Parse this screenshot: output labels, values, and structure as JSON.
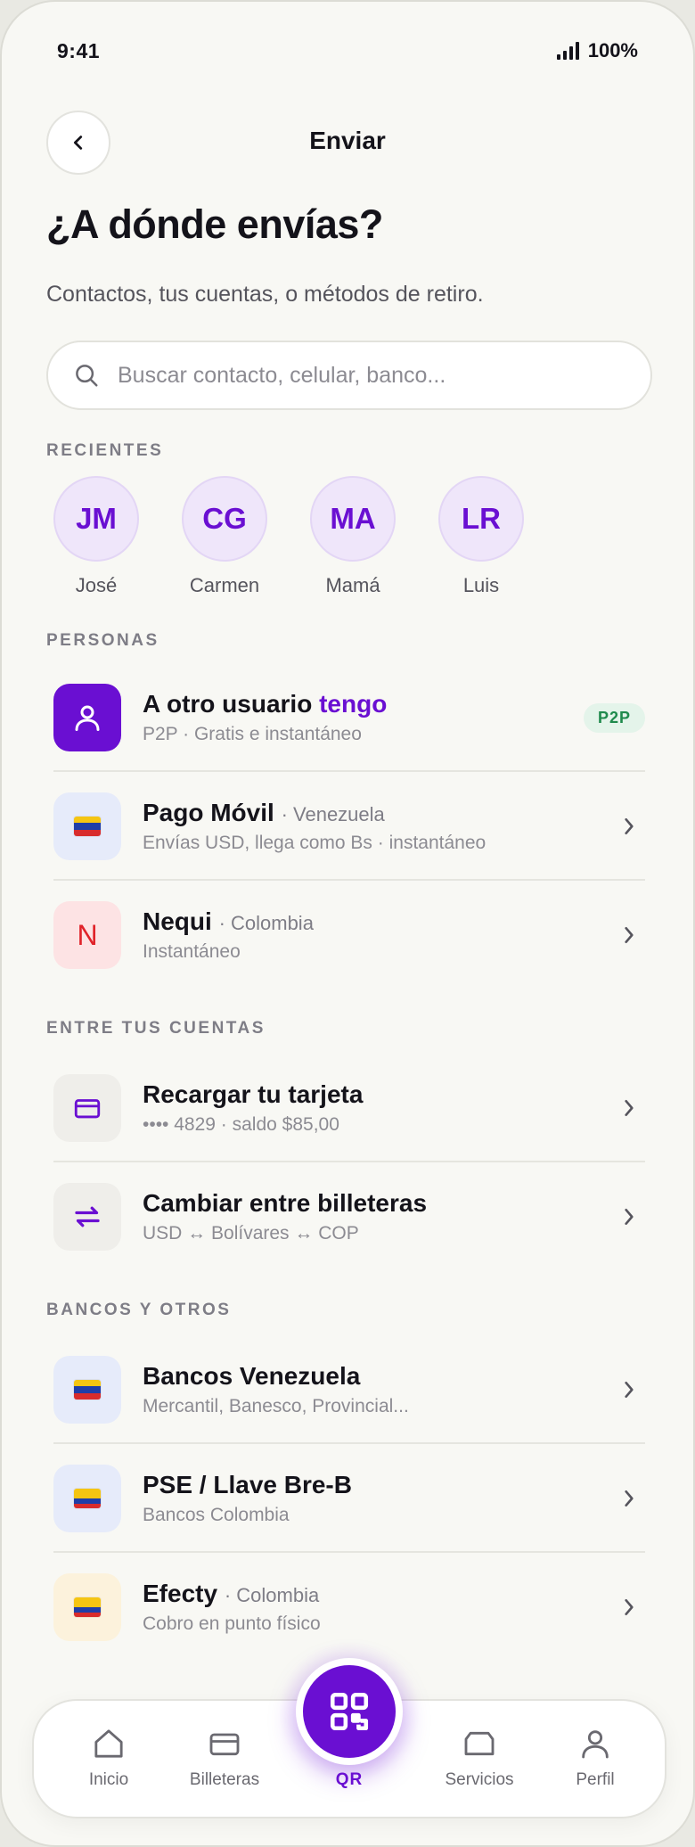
{
  "status": {
    "time": "9:41",
    "battery": "100%"
  },
  "header": {
    "title": "Enviar"
  },
  "heading": "¿A dónde envías?",
  "subtitle": "Contactos, tus cuentas, o métodos de retiro.",
  "search": {
    "placeholder": "Buscar contacto, celular, banco..."
  },
  "sections": {
    "recientes": "RECIENTES",
    "personas": "PERSONAS",
    "entre_cuentas": "ENTRE TUS CUENTAS",
    "bancos": "BANCOS Y OTROS"
  },
  "recents": [
    {
      "initials": "JM",
      "name": "José"
    },
    {
      "initials": "CG",
      "name": "Carmen"
    },
    {
      "initials": "MA",
      "name": "Mamá"
    },
    {
      "initials": "LR",
      "name": "Luis"
    }
  ],
  "personas": [
    {
      "title": "A otro usuario",
      "accent": "tengo",
      "subtitle": "P2P · Gratis e instantáneo",
      "badge": "P2P"
    },
    {
      "title": "Pago Móvil",
      "country": "· Venezuela",
      "subtitle": "Envías USD, llega como Bs · instantáneo"
    },
    {
      "title": "Nequi",
      "country": "· Colombia",
      "subtitle": "Instantáneo",
      "letter": "N"
    }
  ],
  "cuentas": [
    {
      "title": "Recargar tu tarjeta",
      "subtitle": "•••• 4829 · saldo $85,00"
    },
    {
      "title": "Cambiar entre billeteras",
      "subtitle": "USD ↔ Bolívares ↔ COP"
    }
  ],
  "bancos": [
    {
      "title": "Bancos Venezuela",
      "subtitle": "Mercantil, Banesco, Provincial..."
    },
    {
      "title": "PSE / Llave Bre-B",
      "subtitle": "Bancos Colombia"
    },
    {
      "title": "Efecty",
      "country": "· Colombia",
      "subtitle": "Cobro en punto físico"
    }
  ],
  "tabbar": {
    "inicio": "Inicio",
    "billeteras": "Billeteras",
    "qr": "QR",
    "servicios": "Servicios",
    "perfil": "Perfil"
  },
  "colors": {
    "accent": "#6a0fd2",
    "p2p_badge": "#1f8a4c"
  }
}
